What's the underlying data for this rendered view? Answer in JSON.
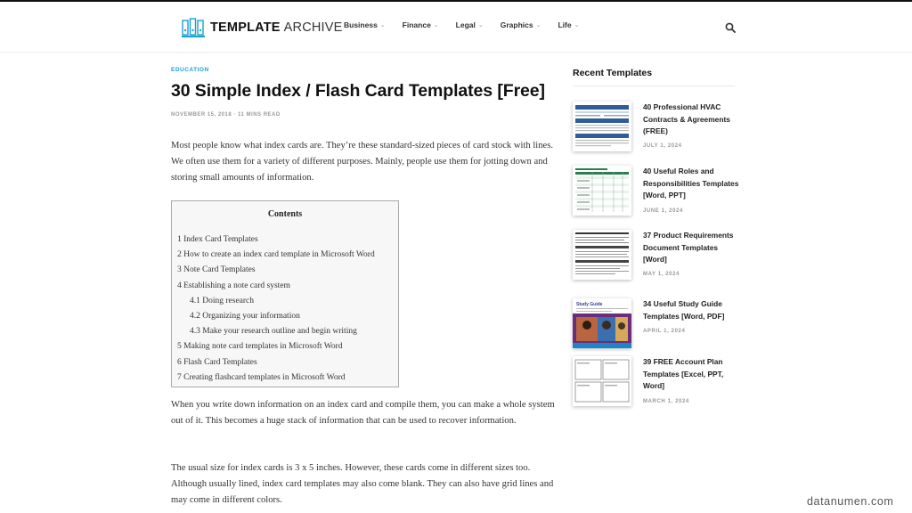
{
  "header": {
    "logo_bold": "TEMPLATE",
    "logo_light": "ARCHIVE",
    "nav": [
      {
        "label": "Business"
      },
      {
        "label": "Finance"
      },
      {
        "label": "Legal"
      },
      {
        "label": "Graphics"
      },
      {
        "label": "Life"
      }
    ],
    "search_icon": "search-icon"
  },
  "article": {
    "category": "EDUCATION",
    "title": "30 Simple Index / Flash Card Templates [Free]",
    "meta": "NOVEMBER 15, 2018 · 11 MINS READ",
    "p1": "Most people know what index cards are. They’re these standard-sized pieces of card stock with lines. We often use them for a variety of different purposes. Mainly, people use them for jotting down and storing small amounts of information.",
    "p2": "When you write down information on an index card and compile them, you can make a whole system out of it. This becomes a huge stack of information that can be used to recover information.",
    "p3": "The usual size for index cards is 3 x 5 inches. However, these cards come in different sizes too. Although usually lined, index card templates may also come blank. They can also have grid lines and may come in different colors."
  },
  "toc": {
    "title": "Contents",
    "items": [
      "1 Index Card Templates",
      "2 How to create an index card template in Microsoft Word",
      "3 Note Card Templates",
      "4 Establishing a note card system",
      "4.1 Doing research",
      "4.2 Organizing your information",
      "4.3 Make your research outline and begin writing",
      "5 Making note card templates in Microsoft Word",
      "6 Flash Card Templates",
      "7 Creating flashcard templates in Microsoft Word"
    ]
  },
  "sidebar": {
    "heading": "Recent Templates",
    "posts": [
      {
        "title": "40 Professional HVAC Contracts & Agreements (FREE)",
        "date": "JULY 1, 2024"
      },
      {
        "title": "40 Useful Roles and Responsibilities Templates [Word, PPT]",
        "date": "JUNE 1, 2024"
      },
      {
        "title": "37 Product Requirements Document Templates [Word]",
        "date": "MAY 1, 2024"
      },
      {
        "title": "34 Useful Study Guide Templates [Word, PDF]",
        "date": "APRIL 1, 2024",
        "thumb_label": "Study Guide"
      },
      {
        "title": "39 FREE Account Plan Templates [Excel, PPT, Word]",
        "date": "MARCH 1, 2024"
      }
    ]
  },
  "watermark": "datanumen.com",
  "colors": {
    "accent": "#1a9fd6",
    "text": "#222222",
    "muted": "#999999"
  }
}
